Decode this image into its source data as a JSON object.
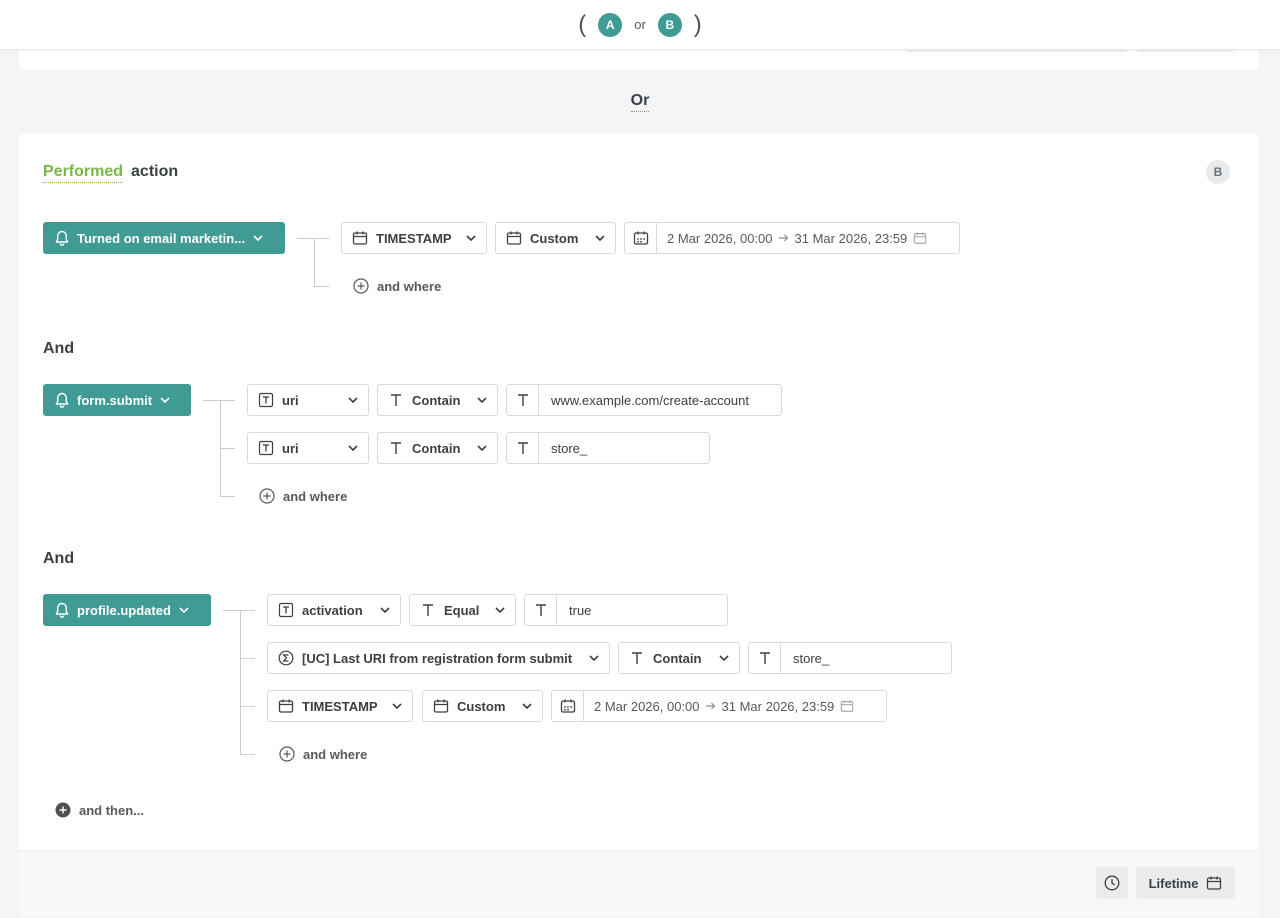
{
  "topbar": {
    "group_a": "A",
    "or_label": "or",
    "group_b": "B",
    "paren_open": "(",
    "paren_close": ")"
  },
  "separator": {
    "label": "Or"
  },
  "card": {
    "heading_performed": "Performed",
    "heading_action": "action",
    "group_badge": "B",
    "blocks": [
      {
        "event": "Turned on email marketin...",
        "conditions": [
          {
            "type": "date",
            "property": "TIMESTAMP",
            "operator": "Custom",
            "date_from": "2 Mar 2026, 00:00",
            "date_to": "31 Mar 2026, 23:59"
          }
        ],
        "add_where": "and where"
      },
      {
        "connector": "And",
        "event": "form.submit",
        "conditions": [
          {
            "type": "text",
            "property": "uri",
            "operator": "Contain",
            "value": "www.example.com/create-account"
          },
          {
            "type": "text",
            "property": "uri",
            "operator": "Contain",
            "value": "store_"
          }
        ],
        "add_where": "and where"
      },
      {
        "connector": "And",
        "event": "profile.updated",
        "conditions": [
          {
            "type": "text",
            "property": "activation",
            "operator": "Equal",
            "value": "true"
          },
          {
            "type": "computed",
            "property": "[UC] Last URI from registration form submit",
            "operator": "Contain",
            "value": "store_"
          },
          {
            "type": "date",
            "property": "TIMESTAMP",
            "operator": "Custom",
            "date_from": "2 Mar 2026, 00:00",
            "date_to": "31 Mar 2026, 23:59"
          }
        ],
        "add_where": "and where"
      }
    ],
    "and_then": "and then..."
  },
  "footer": {
    "lifetime_label": "Lifetime"
  },
  "colors": {
    "accent": "#3f9b93",
    "performed": "#7ab648"
  }
}
